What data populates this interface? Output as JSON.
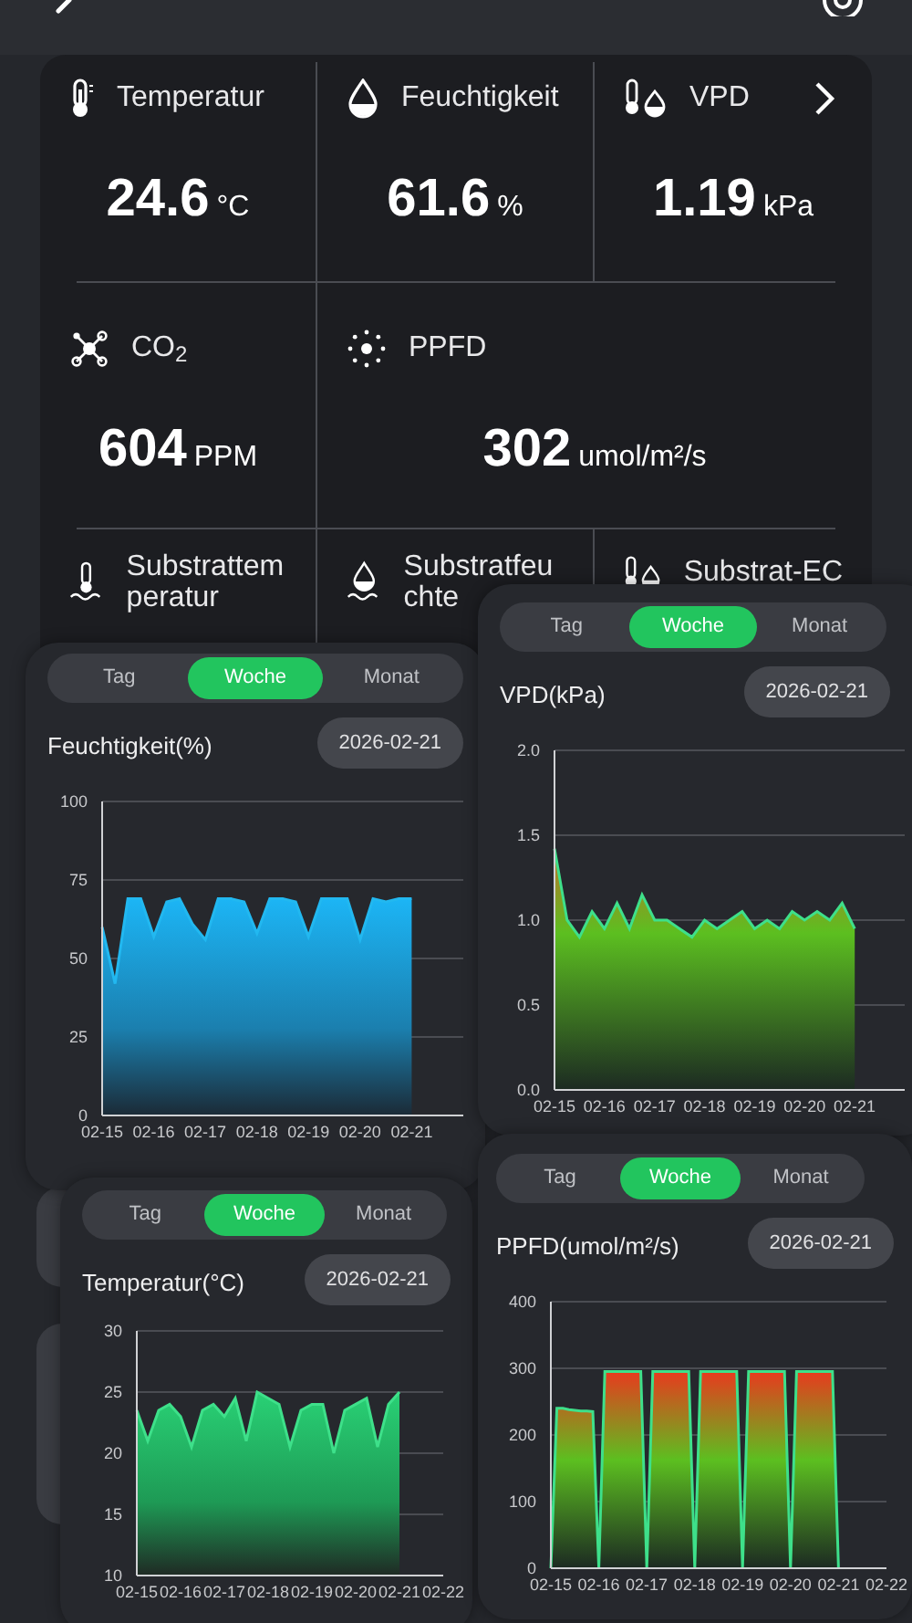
{
  "sensors": [
    {
      "label": "Temperatur",
      "value": "24.6",
      "unit": "°C"
    },
    {
      "label": "Feuchtigkeit",
      "value": "61.6",
      "unit": "%"
    },
    {
      "label": "VPD",
      "value": "1.19",
      "unit": "kPa"
    },
    {
      "label": "CO$_{2}$",
      "value": "604",
      "unit": "PPM"
    },
    {
      "label": "PPFD",
      "value": "302",
      "unit": "umol/m²/s"
    },
    {
      "label": "Substrattemperatur"
    },
    {
      "label": "Substratfeuchte"
    },
    {
      "label": "Substrat-EC"
    }
  ],
  "charts": [
    {
      "tabs": [
        {
          "label": "Tag",
          "selected": false
        },
        {
          "label": "Woche",
          "selected": true
        },
        {
          "label": "Monat",
          "selected": false
        }
      ],
      "title": "Feuchtigkeit(%)",
      "date": "2026-02-21",
      "chart_data": {
        "type": "area",
        "categories": [
          "02-15",
          null,
          null,
          null,
          "02-16",
          null,
          null,
          null,
          "02-17",
          null,
          null,
          null,
          "02-18",
          null,
          null,
          null,
          "02-19",
          null,
          null,
          null,
          "02-20",
          null,
          null,
          null,
          "02-21",
          null,
          null,
          null,
          null
        ],
        "series": [
          {
            "color": "#22b8f0",
            "values": [
              60,
              42,
              69,
              69,
              57,
              68,
              69,
              61,
              56,
              69,
              69,
              68,
              58,
              69,
              69,
              68,
              57,
              69,
              69,
              69,
              56,
              69,
              68,
              69,
              69,
              null,
              null,
              null,
              null
            ]
          }
        ],
        "grid": true,
        "ylim": [
          0,
          100
        ],
        "yticks": [
          0,
          25,
          50,
          75,
          100
        ]
      }
    },
    {
      "tabs": [
        {
          "label": "Tag",
          "selected": false
        },
        {
          "label": "Woche",
          "selected": true
        },
        {
          "label": "Monat",
          "selected": false
        }
      ],
      "title": "VPD(kPa)",
      "date": "2026-02-21",
      "chart_data": {
        "type": "area",
        "categories": [
          "02-15",
          null,
          null,
          null,
          "02-16",
          null,
          null,
          null,
          "02-17",
          null,
          null,
          null,
          "02-18",
          null,
          null,
          null,
          "02-19",
          null,
          null,
          null,
          "02-20",
          null,
          null,
          null,
          "02-21",
          null,
          null,
          null,
          null
        ],
        "series": [
          {
            "color": "#3ee08a",
            "values": [
              1.42,
              1.0,
              0.9,
              1.05,
              0.95,
              1.1,
              0.95,
              1.15,
              1.0,
              1.0,
              0.95,
              0.9,
              1.0,
              0.95,
              1.0,
              1.05,
              0.95,
              1.0,
              0.95,
              1.05,
              1.0,
              1.05,
              1.0,
              1.1,
              0.95,
              null,
              null,
              null,
              null
            ]
          }
        ],
        "grid": true,
        "ylim": [
          0,
          2
        ],
        "yticks": [
          {
            "value": 0,
            "label": "0.0"
          },
          {
            "value": 0.5,
            "label": "0.5"
          },
          {
            "value": 1,
            "label": "1.0"
          },
          {
            "value": 1.5,
            "label": "1.5"
          },
          {
            "value": 2,
            "label": "2.0"
          }
        ]
      }
    },
    {
      "tabs": [
        {
          "label": "Tag",
          "selected": false
        },
        {
          "label": "Woche",
          "selected": true
        },
        {
          "label": "Monat",
          "selected": false
        }
      ],
      "title": "Temperatur(°C)",
      "date": "2026-02-21",
      "chart_data": {
        "type": "area",
        "categories": [
          "02-15",
          null,
          null,
          null,
          "02-16",
          null,
          null,
          null,
          "02-17",
          null,
          null,
          null,
          "02-18",
          null,
          null,
          null,
          "02-19",
          null,
          null,
          null,
          "02-20",
          null,
          null,
          null,
          "02-21",
          null,
          null,
          null,
          "02-22"
        ],
        "grid": true,
        "series": [
          {
            "color": "#3ee08a",
            "values": [
              23.5,
              21,
              23.5,
              24,
              23,
              20.5,
              23.5,
              24,
              23,
              24.5,
              21,
              25,
              24.5,
              24,
              20.5,
              23.5,
              24,
              24,
              20,
              23.5,
              24,
              24.5,
              20.5,
              24,
              25,
              null,
              null,
              null,
              null
            ]
          }
        ],
        "ylim": [
          10,
          30
        ],
        "yticks": [
          10,
          15,
          20,
          25,
          30
        ]
      }
    },
    {
      "tabs": [
        {
          "label": "Tag",
          "selected": false
        },
        {
          "label": "Woche",
          "selected": true
        },
        {
          "label": "Monat",
          "selected": false
        }
      ],
      "title": "PPFD(umol/m²/s)",
      "date": "2026-02-21",
      "chart_data": {
        "type": "area",
        "categories": [
          "02-15",
          null,
          null,
          null,
          null,
          null,
          null,
          null,
          "02-16",
          null,
          null,
          null,
          null,
          null,
          null,
          null,
          "02-17",
          null,
          null,
          null,
          null,
          null,
          null,
          null,
          "02-18",
          null,
          null,
          null,
          null,
          null,
          null,
          null,
          "02-19",
          null,
          null,
          null,
          null,
          null,
          null,
          null,
          "02-20",
          null,
          null,
          null,
          null,
          null,
          null,
          null,
          "02-21",
          null,
          null,
          null,
          null,
          null,
          null,
          null,
          "02-22"
        ],
        "series": [
          {
            "color": "#3ee08a",
            "values": [
              0,
              240,
              240,
              238,
              237,
              236,
              236,
              235,
              0,
              295,
              295,
              295,
              295,
              295,
              295,
              295,
              0,
              295,
              295,
              295,
              295,
              295,
              295,
              295,
              0,
              295,
              295,
              295,
              295,
              295,
              295,
              295,
              0,
              295,
              295,
              295,
              295,
              295,
              295,
              295,
              0,
              295,
              295,
              295,
              295,
              295,
              295,
              295,
              0,
              null,
              null,
              null,
              null,
              null,
              null,
              null,
              null
            ]
          }
        ],
        "grid": true,
        "ylim": [
          0,
          400
        ],
        "yticks": [
          0,
          100,
          200,
          300,
          400
        ]
      }
    }
  ]
}
